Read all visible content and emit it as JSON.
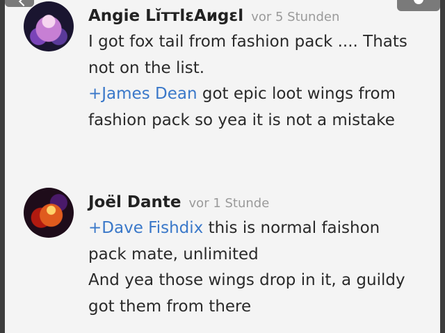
{
  "comments": [
    {
      "author": "Angie LĭттlɛAиgɛl",
      "timestamp": "vor 5 Stunden",
      "paragraphs": [
        {
          "mention": "",
          "text": "I got fox tail from fashion pack .... Thats not on the list."
        },
        {
          "mention": "+James Dean",
          "text": " got epic loot wings from fashion pack so yea it is not a mistake"
        }
      ]
    },
    {
      "author": "Joël Dante",
      "timestamp": "vor 1 Stunde",
      "paragraphs": [
        {
          "mention": "+Dave Fishdix",
          "text": " this is normal faishon pack mate, unlimited"
        },
        {
          "mention": "",
          "text": "And yea those wings drop in it, a guildy got them from there"
        }
      ]
    }
  ],
  "colors": {
    "background": "#f4f4f4",
    "mention": "#3a78c9",
    "author": "#222222",
    "timestamp": "#9a9a9a",
    "side_bars": "#3d3d3d"
  },
  "icons": {
    "top_left": "back-arrow-icon",
    "top_right": "overflow-icon"
  }
}
